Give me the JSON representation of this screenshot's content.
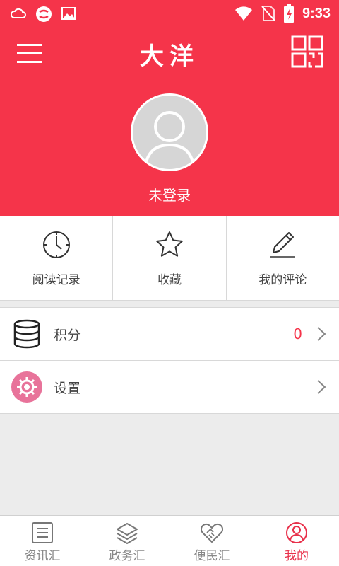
{
  "status_bar": {
    "time": "9:33"
  },
  "header": {
    "title": "大洋",
    "login_text": "未登录"
  },
  "quick_actions": [
    {
      "label": "阅读记录",
      "icon": "clock-icon"
    },
    {
      "label": "收藏",
      "icon": "star-icon"
    },
    {
      "label": "我的评论",
      "icon": "pencil-icon"
    }
  ],
  "list": [
    {
      "label": "积分",
      "value": "0",
      "icon": "database-icon"
    },
    {
      "label": "设置",
      "value": "",
      "icon": "gear-icon"
    }
  ],
  "tabs": [
    {
      "label": "资讯汇",
      "icon": "document-icon",
      "active": false
    },
    {
      "label": "政务汇",
      "icon": "layers-icon",
      "active": false
    },
    {
      "label": "便民汇",
      "icon": "handshake-icon",
      "active": false
    },
    {
      "label": "我的",
      "icon": "user-circle-icon",
      "active": true
    }
  ],
  "colors": {
    "brand": "#f5344a",
    "active_tab": "#e8304a",
    "settings_icon_bg": "#e8739a"
  }
}
